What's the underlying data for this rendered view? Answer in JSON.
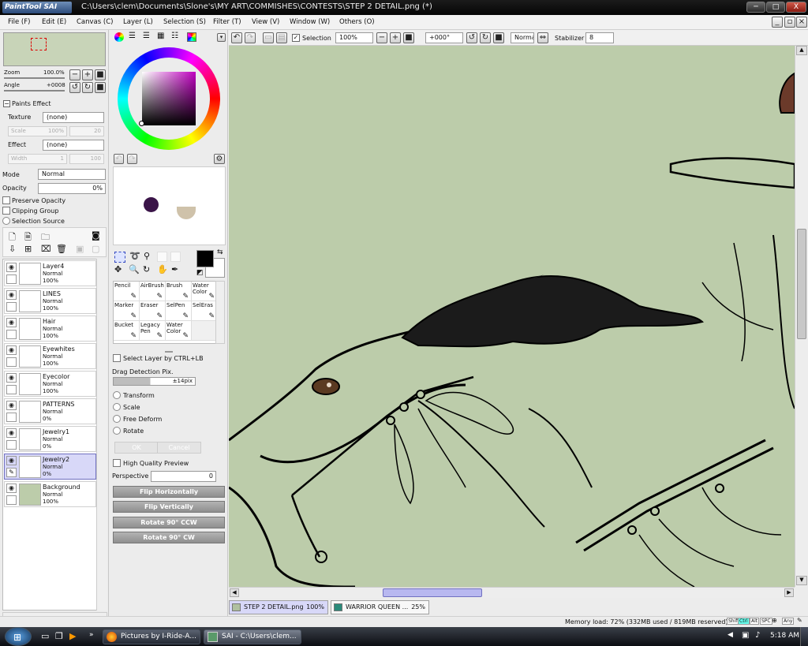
{
  "title_bar": {
    "logo_text": "PaintTool SAI",
    "title": "C:\\Users\\clem\\Documents\\Slone's\\MY ART\\COMMISHES\\CONTESTS\\STEP 2 DETAIL.png (*)",
    "min": "─",
    "max": "□",
    "close": "X"
  },
  "menu": [
    "File (F)",
    "Edit (E)",
    "Canvas (C)",
    "Layer (L)",
    "Selection (S)",
    "Filter (T)",
    "View (V)",
    "Window (W)",
    "Others (O)"
  ],
  "navigator": {
    "zoom_label": "Zoom",
    "zoom_value": "100.0%",
    "angle_label": "Angle",
    "angle_value": "+0008"
  },
  "paints_effect": {
    "header": "Paints Effect",
    "texture_label": "Texture",
    "texture_value": "(none)",
    "scale_label": "Scale",
    "scale_value": "100%",
    "scale_num": "20",
    "effect_label": "Effect",
    "effect_value": "(none)",
    "width_label": "Width",
    "width_value": "1",
    "width_num": "100"
  },
  "layer_props": {
    "mode_label": "Mode",
    "mode_value": "Normal",
    "opacity_label": "Opacity",
    "opacity_value": "0%",
    "preserve_opacity": "Preserve Opacity",
    "clipping_group": "Clipping Group",
    "selection_source": "Selection Source"
  },
  "layers": [
    {
      "name": "Layer4",
      "mode": "Normal",
      "opacity": "100%",
      "selected": false
    },
    {
      "name": "LINES",
      "mode": "Normal",
      "opacity": "100%",
      "selected": false
    },
    {
      "name": "Hair",
      "mode": "Normal",
      "opacity": "100%",
      "selected": false
    },
    {
      "name": "Eyewhites",
      "mode": "Normal",
      "opacity": "100%",
      "selected": false
    },
    {
      "name": "Eyecolor",
      "mode": "Normal",
      "opacity": "100%",
      "selected": false
    },
    {
      "name": "PATTERNS",
      "mode": "Normal",
      "opacity": "0%",
      "selected": false
    },
    {
      "name": "Jewelry1",
      "mode": "Normal",
      "opacity": "0%",
      "selected": false
    },
    {
      "name": "Jewelry2",
      "mode": "Normal",
      "opacity": "0%",
      "selected": true
    },
    {
      "name": "Background",
      "mode": "Normal",
      "opacity": "100%",
      "selected": false
    }
  ],
  "colors": {
    "primary": "#000000",
    "swatch1": "#3a1448",
    "swatch2": "#cfc2aa",
    "canvas_bg": "#bcccaa",
    "selected_layer": "#d8d8f8"
  },
  "tools": [
    {
      "label": "Pencil"
    },
    {
      "label": "AirBrush"
    },
    {
      "label": "Brush"
    },
    {
      "label": "Water Color"
    },
    {
      "label": "Marker"
    },
    {
      "label": "Eraser"
    },
    {
      "label": "SelPen"
    },
    {
      "label": "SelEras"
    },
    {
      "label": "Bucket"
    },
    {
      "label": "Legacy Pen"
    },
    {
      "label": "Water Color"
    }
  ],
  "selection_panel": {
    "select_layer": "Select Layer by CTRL+LB",
    "drag_label": "Drag Detection Pix.",
    "drag_value": "±14pix",
    "options": [
      "Transform",
      "Scale",
      "Free Deform",
      "Rotate"
    ],
    "ok": "OK",
    "cancel": "Cancel",
    "hq_preview": "High Quality Preview",
    "perspective_label": "Perspective",
    "perspective_value": "0",
    "flip_h": "Flip Horizontally",
    "flip_v": "Flip Vertically",
    "rot_ccw": "Rotate 90° CCW",
    "rot_cw": "Rotate 90° CW"
  },
  "toolbar": {
    "selection_label": "Selection",
    "zoom_value": "100%",
    "angle_value": "+000°",
    "mode_value": "Normal",
    "stabilizer_label": "Stabilizer",
    "stabilizer_value": "8"
  },
  "tabs": [
    {
      "name": "STEP 2 DETAIL.png",
      "zoom": "100%",
      "active": true
    },
    {
      "name": "WARRIOR QUEEN ...",
      "zoom": "25%",
      "active": false
    }
  ],
  "status": {
    "memory": "Memory load: 72% (332MB used / 819MB reserved)",
    "keys": [
      "Shift",
      "Ctrl",
      "Alt",
      "SPC",
      "Any"
    ]
  },
  "taskbar": {
    "tasks": [
      "Pictures by I-Ride-A...",
      "SAI - C:\\Users\\clem..."
    ],
    "clock": "5:18 AM"
  }
}
